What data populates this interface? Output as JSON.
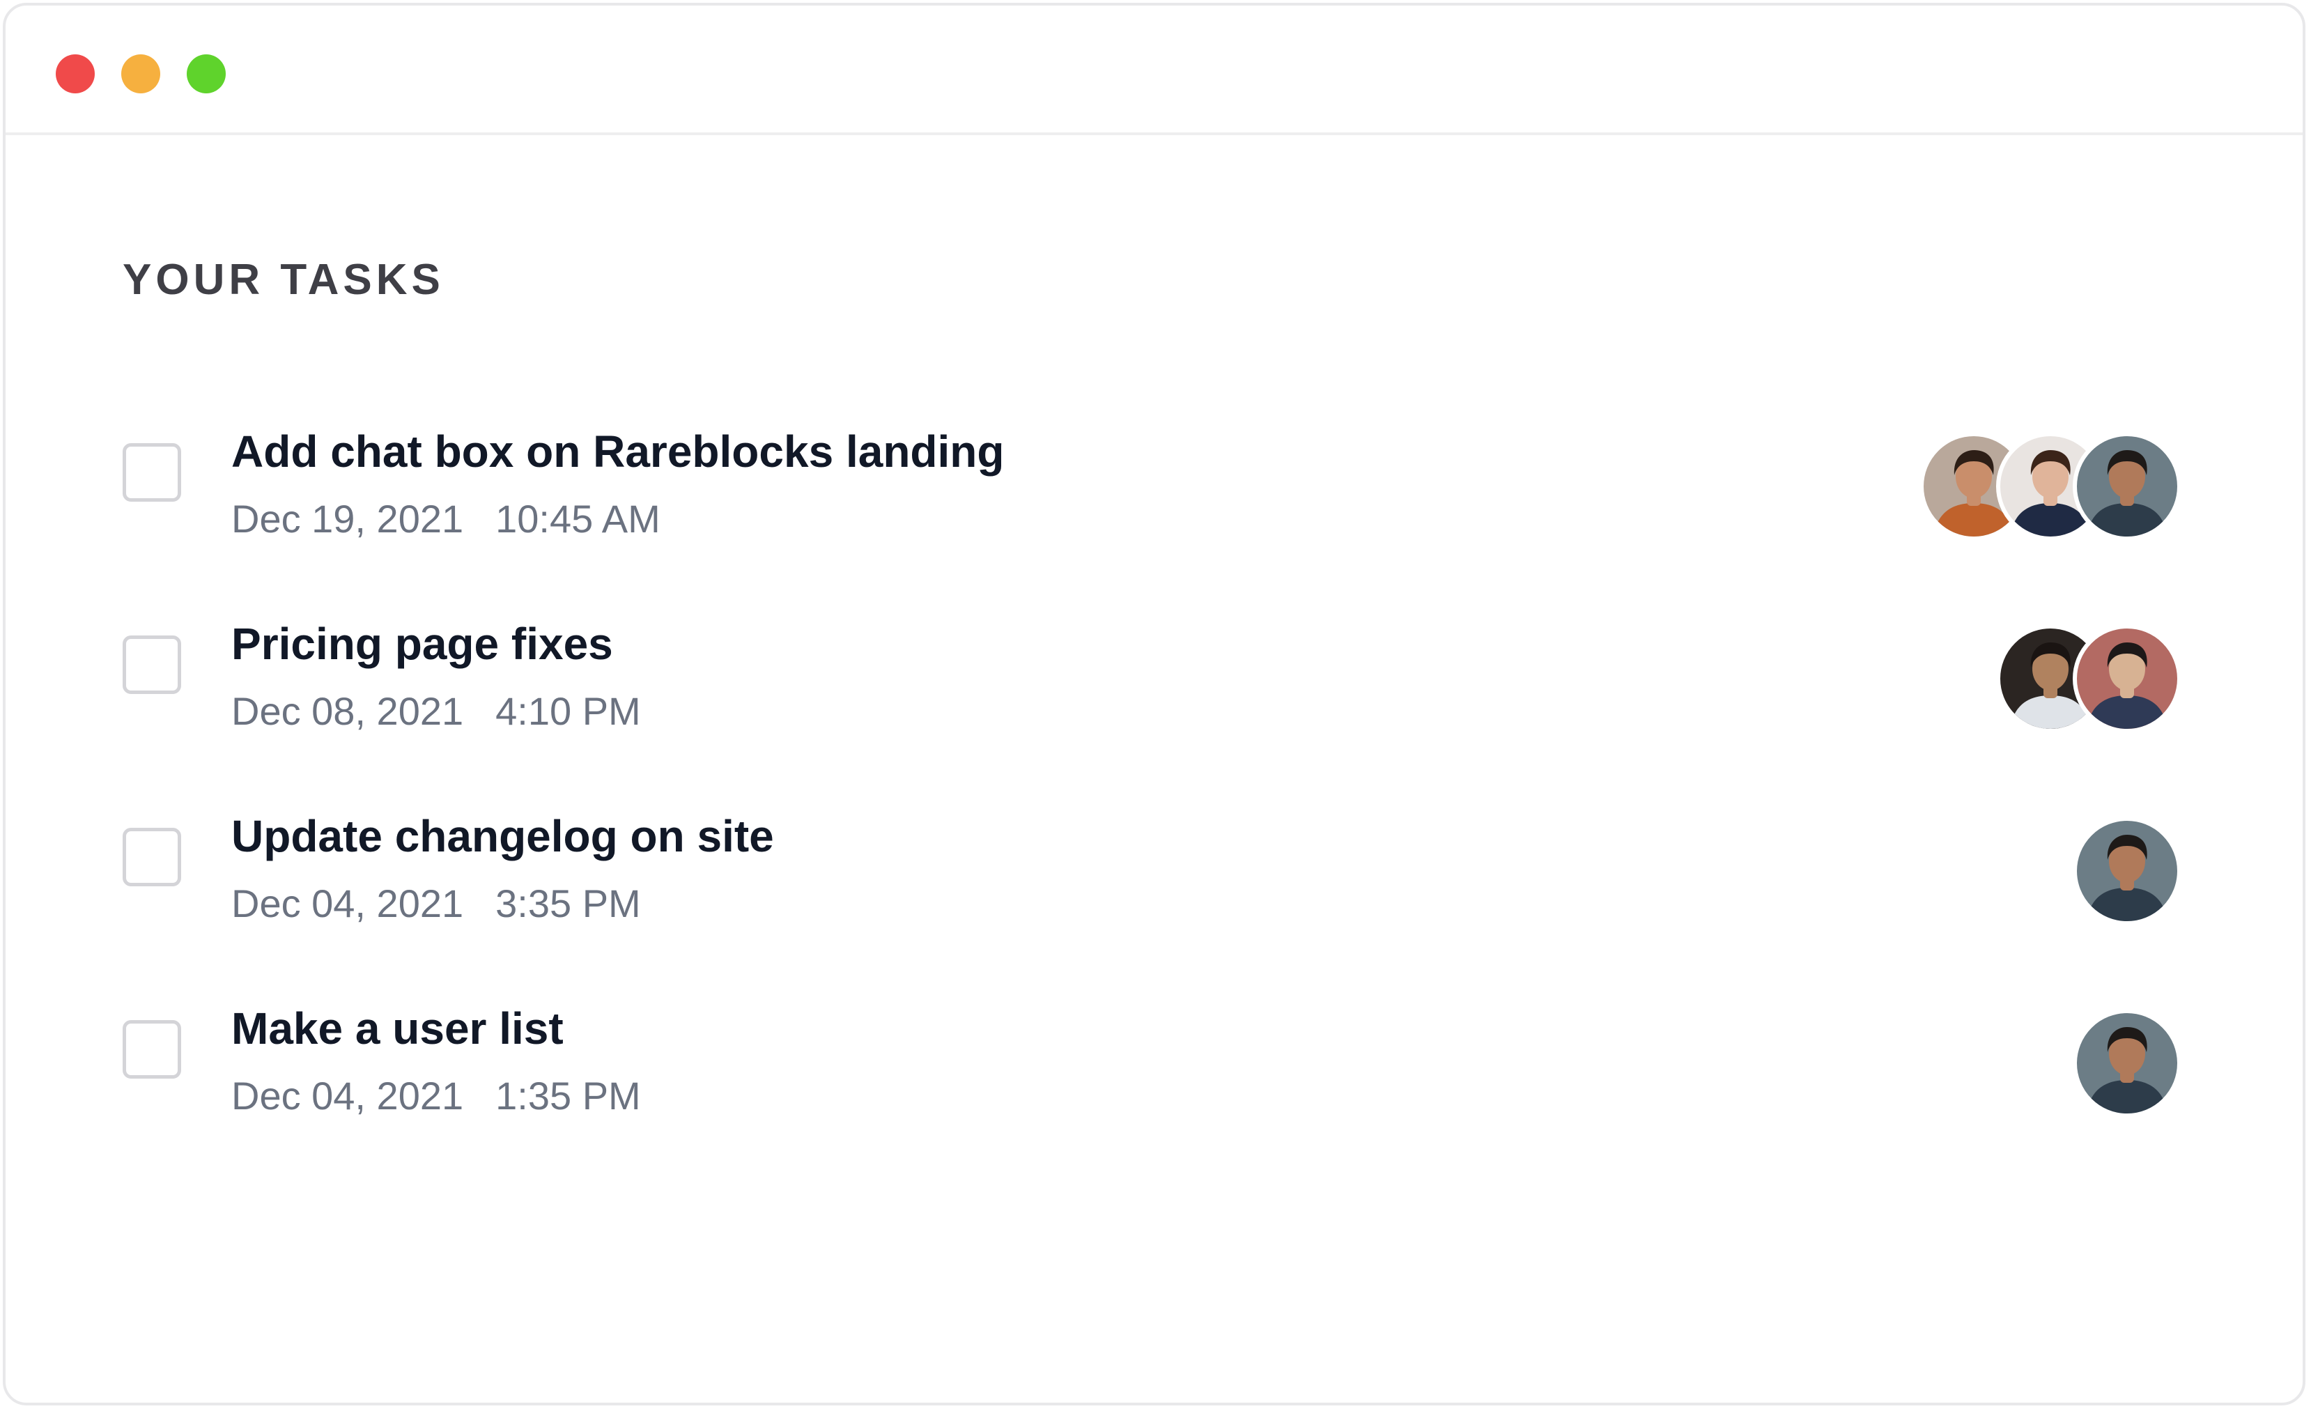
{
  "window": {
    "controls": [
      {
        "name": "close",
        "color": "#f04a4a"
      },
      {
        "name": "minimize",
        "color": "#f6b03f"
      },
      {
        "name": "maximize",
        "color": "#5fd32c"
      }
    ]
  },
  "section": {
    "title": "YOUR TASKS"
  },
  "tasks": [
    {
      "title": "Add chat box on Rareblocks landing",
      "date": "Dec 19, 2021",
      "time": "10:45 AM",
      "checked": false,
      "avatars": [
        {
          "bg": "#b9a89b",
          "skin": "#c98e6b",
          "hair": "#2d1e16",
          "shirt": "#c0622c"
        },
        {
          "bg": "#e9e4e1",
          "skin": "#e0b49a",
          "hair": "#3b2419",
          "shirt": "#1f2a44"
        },
        {
          "bg": "#6c7d86",
          "skin": "#b07a5a",
          "hair": "#1e1a18",
          "shirt": "#2d3c4a"
        }
      ]
    },
    {
      "title": "Pricing page fixes",
      "date": "Dec 08, 2021",
      "time": "4:10 PM",
      "checked": false,
      "avatars": [
        {
          "bg": "#2b2522",
          "skin": "#b0825f",
          "hair": "#1a1412",
          "shirt": "#dfe3e8"
        },
        {
          "bg": "#b36a63",
          "skin": "#d7b293",
          "hair": "#1c1818",
          "shirt": "#2f3a56"
        }
      ]
    },
    {
      "title": "Update changelog on site",
      "date": "Dec 04, 2021",
      "time": "3:35 PM",
      "checked": false,
      "avatars": [
        {
          "bg": "#6c7d86",
          "skin": "#b07a5a",
          "hair": "#1e1a18",
          "shirt": "#2d3c4a"
        }
      ]
    },
    {
      "title": "Make a user list",
      "date": "Dec 04, 2021",
      "time": "1:35 PM",
      "checked": false,
      "avatars": [
        {
          "bg": "#6c7d86",
          "skin": "#b07a5a",
          "hair": "#1e1a18",
          "shirt": "#2d3c4a"
        }
      ]
    }
  ]
}
